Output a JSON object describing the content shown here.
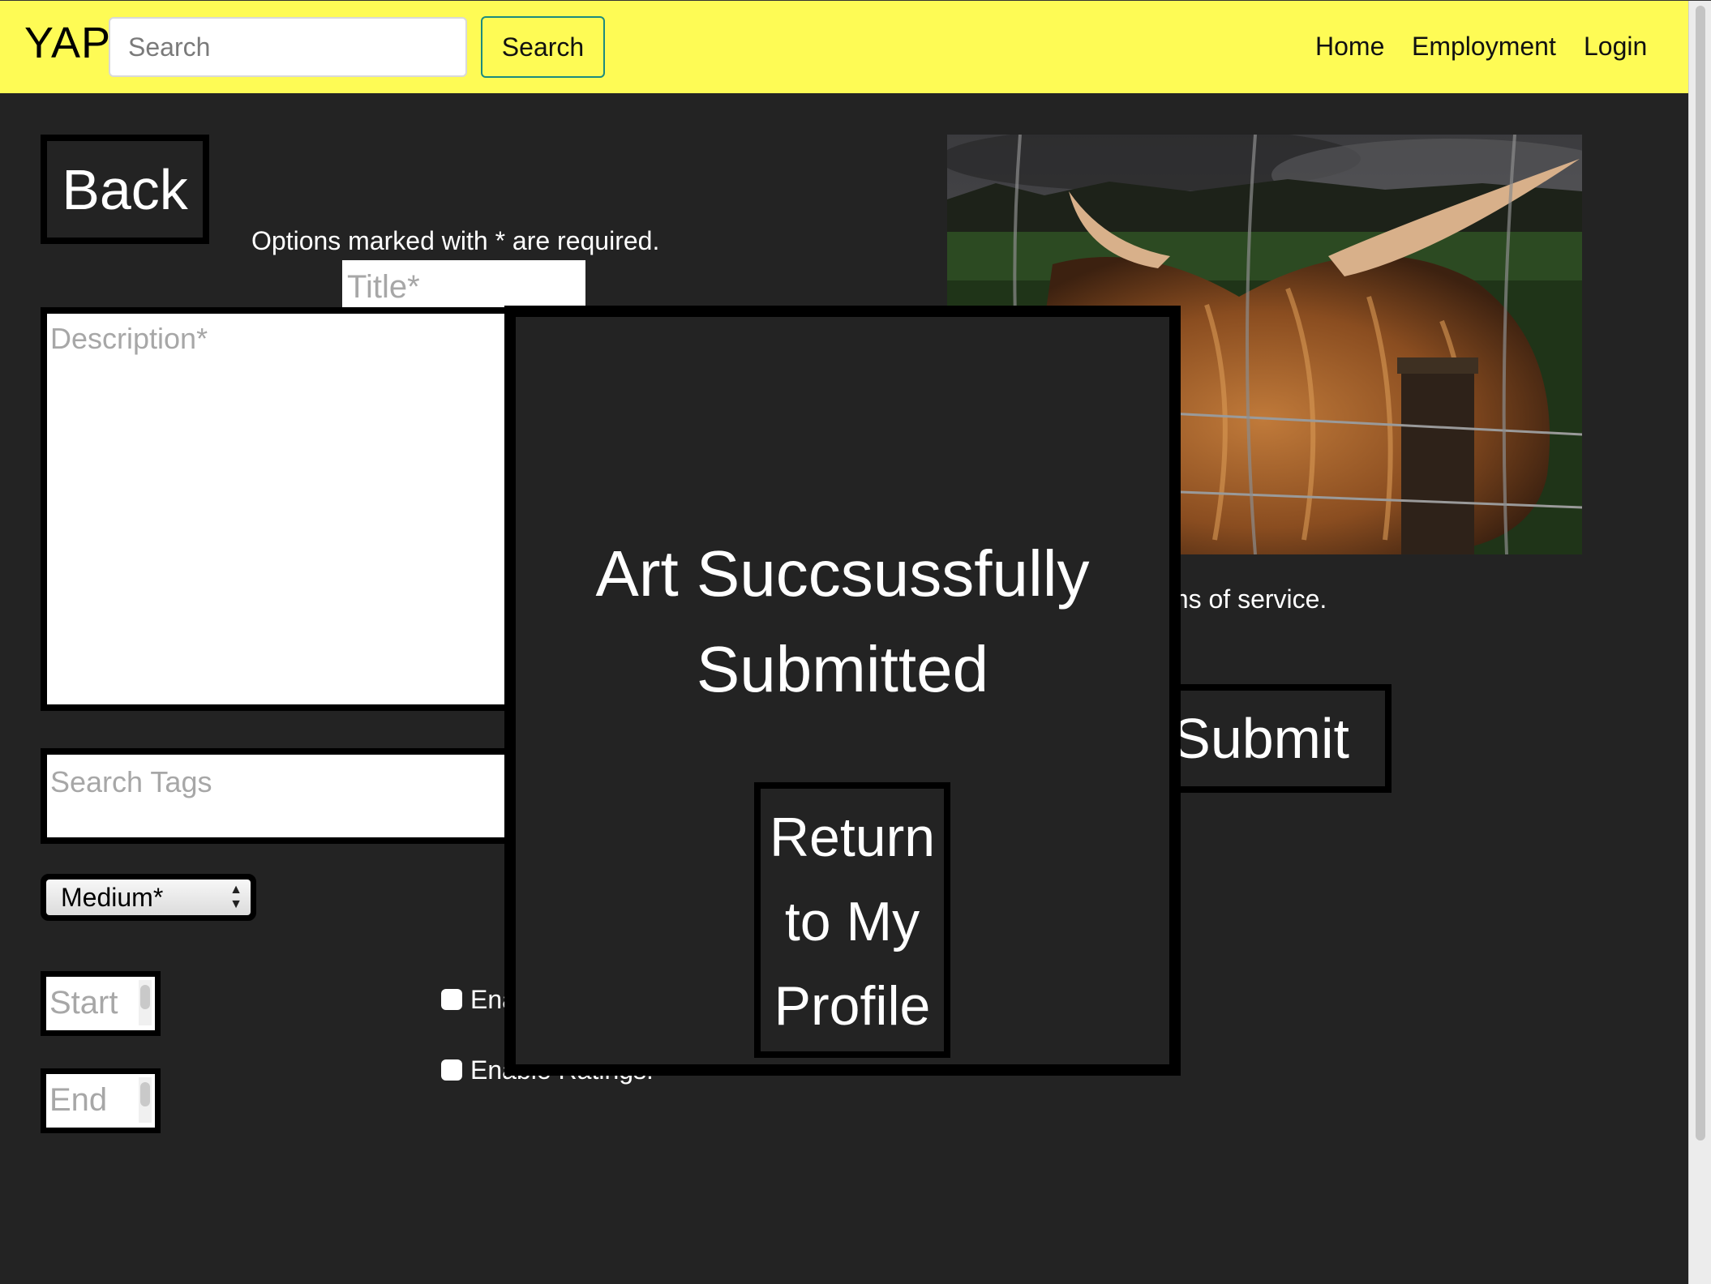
{
  "navbar": {
    "brand": "YAP",
    "search_placeholder": "Search",
    "search_button": "Search",
    "links": [
      "Home",
      "Employment",
      "Login"
    ]
  },
  "form": {
    "back_button": "Back",
    "required_note": "Options marked with * are required.",
    "title_placeholder": "Title*",
    "description_placeholder": "Description*",
    "tags_placeholder": "Search Tags",
    "medium_selected": "Medium*",
    "start_placeholder": "Start",
    "end_placeholder": "End",
    "checkbox_1_label_visible": "Ena",
    "checkbox_2_label_visible": "Enable Ratings:",
    "terms_visible": "e read and agree to the terms of service.",
    "submit_button": "Submit"
  },
  "modal": {
    "title": "Art Succsussfully Submitted",
    "button": "Return to My Profile"
  },
  "image": {
    "subject": "highland-cow-photo"
  },
  "colors": {
    "navbar_bg": "#fefb55",
    "page_bg": "#232323",
    "border": "#000000",
    "search_button_border": "#1c8b7e"
  }
}
